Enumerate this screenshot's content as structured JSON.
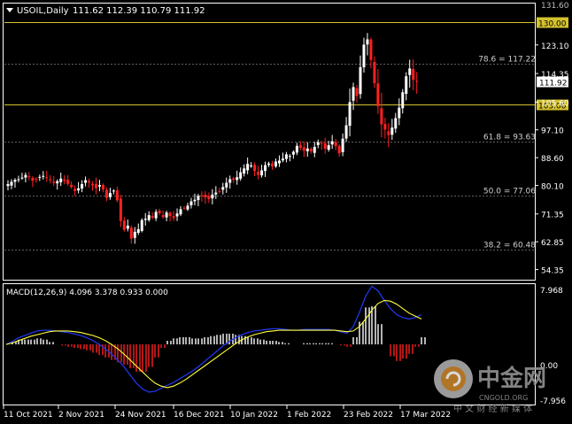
{
  "header": {
    "symbol": "USOIL,Daily",
    "ohlc": "111.62 112.39 110.79 111.92"
  },
  "price_axis": {
    "labels": [
      "123.10",
      "114.35",
      "105.60",
      "97.10",
      "88.60",
      "80.10",
      "71.35",
      "62.85",
      "54.35"
    ],
    "top_partial": "131.60",
    "current_price": "111.92",
    "level_130": "130.00",
    "level_105": "105.00"
  },
  "fib_levels": [
    {
      "label": "78.6 = 117.22",
      "price": 117.22
    },
    {
      "label": "61.8 = 93.63",
      "price": 93.63
    },
    {
      "label": "50.0 = 77.06",
      "price": 77.06
    },
    {
      "label": "38.2 = 60.48",
      "price": 60.48
    }
  ],
  "macd": {
    "label": "MACD(12,26,9) 4.096 3.378 0.933 0.000",
    "axis_top": "7.968",
    "axis_zero": "0.00",
    "axis_bottom": "-7.956"
  },
  "time_axis": [
    "11 Oct 2021",
    "2 Nov 2021",
    "24 Nov 2021",
    "16 Dec 2021",
    "10 Jan 2022",
    "1 Feb 2022",
    "23 Feb 2022",
    "17 Mar 2022"
  ],
  "watermark": {
    "brand": "中金网",
    "domain": "CNGOLD.ORG",
    "tagline": "中 文 财 经 新 媒 体"
  },
  "colors": {
    "background": "#000000",
    "bull": "#ffffff",
    "bear": "#ff2020",
    "horizontal_line": "#d4c22e",
    "macd_line": "#2035e6",
    "signal_line": "#ffff3c",
    "axis_text": "#ffffff",
    "grid": "#606060"
  },
  "chart_data": [
    {
      "type": "candlestick",
      "title": "USOIL,Daily",
      "x": [
        "11 Oct 2021",
        "2 Nov 2021",
        "24 Nov 2021",
        "16 Dec 2021",
        "10 Jan 2022",
        "1 Feb 2022",
        "23 Feb 2022",
        "17 Mar 2022"
      ],
      "ylim": [
        51.5,
        135.5
      ],
      "close_path": [
        80.5,
        81.2,
        81.8,
        82.0,
        82.5,
        83.3,
        82.8,
        81.5,
        82.0,
        82.7,
        83.0,
        82.3,
        81.7,
        80.9,
        81.4,
        82.2,
        81.5,
        80.6,
        79.6,
        78.4,
        79.2,
        80.5,
        81.7,
        81.0,
        80.1,
        79.3,
        80.2,
        78.9,
        76.3,
        77.8,
        78.5,
        75.5,
        69.2,
        66.5,
        67.8,
        63.8,
        65.9,
        66.7,
        69.5,
        69.9,
        71.0,
        70.2,
        72.0,
        71.6,
        70.4,
        71.8,
        70.7,
        70.1,
        71.5,
        72.8,
        73.1,
        73.9,
        75.2,
        75.7,
        76.9,
        77.0,
        76.4,
        75.9,
        77.3,
        77.9,
        78.2,
        79.6,
        80.9,
        82.0,
        81.8,
        82.6,
        84.1,
        85.3,
        86.7,
        86.2,
        84.5,
        83.3,
        84.7,
        86.3,
        86.8,
        85.9,
        87.4,
        87.7,
        88.3,
        89.6,
        89.1,
        90.4,
        92.2,
        91.6,
        90.7,
        91.4,
        90.5,
        91.9,
        93.3,
        92.9,
        91.3,
        92.4,
        93.6,
        92.1,
        89.9,
        94.4,
        98.5,
        105.6,
        110.2,
        107.5,
        116.3,
        123.2,
        124.8,
        118.5,
        111.4,
        104.3,
        98.8,
        97.2,
        95.5,
        97.8,
        100.7,
        103.9,
        108.6,
        113.5,
        115.9,
        112.4,
        111.9
      ]
    },
    {
      "type": "line",
      "title": "MACD(12,26,9) 4.096 3.378 0.933 0.000",
      "ylim": [
        -7.956,
        7.968
      ],
      "series": [
        {
          "name": "MACD",
          "values": [
            0.0,
            0.4,
            0.9,
            1.2,
            1.5,
            1.8,
            1.9,
            1.9,
            1.8,
            1.7,
            1.6,
            1.4,
            1.2,
            0.9,
            0.5,
            0.0,
            -0.6,
            -1.3,
            -2.1,
            -3.0,
            -4.1,
            -5.2,
            -6.0,
            -6.4,
            -6.3,
            -5.9,
            -5.5,
            -5.1,
            -4.6,
            -4.1,
            -3.6,
            -3.0,
            -2.3,
            -1.6,
            -0.9,
            -0.2,
            0.4,
            0.9,
            1.3,
            1.6,
            1.8,
            1.9,
            2.0,
            2.1,
            2.1,
            2.0,
            1.9,
            1.9,
            2.0,
            2.0,
            2.0,
            2.0,
            2.0,
            1.9,
            1.7,
            1.5,
            2.4,
            4.3,
            6.5,
            7.8,
            7.2,
            5.9,
            4.8,
            4.0,
            3.6,
            3.4,
            3.6,
            4.0
          ]
        },
        {
          "name": "Signal",
          "values": [
            0.0,
            0.2,
            0.5,
            0.8,
            1.1,
            1.3,
            1.5,
            1.7,
            1.8,
            1.8,
            1.8,
            1.7,
            1.6,
            1.4,
            1.2,
            0.9,
            0.5,
            0.0,
            -0.6,
            -1.3,
            -2.1,
            -2.9,
            -3.7,
            -4.5,
            -5.2,
            -5.6,
            -5.8,
            -5.6,
            -5.2,
            -4.7,
            -4.1,
            -3.5,
            -2.9,
            -2.3,
            -1.7,
            -1.1,
            -0.5,
            0.1,
            0.6,
            1.0,
            1.3,
            1.5,
            1.7,
            1.8,
            1.9,
            1.9,
            1.9,
            1.9,
            1.9,
            1.9,
            1.9,
            1.9,
            1.9,
            1.9,
            1.8,
            1.7,
            1.8,
            2.4,
            3.4,
            4.6,
            5.5,
            5.9,
            5.8,
            5.4,
            4.8,
            4.2,
            3.8,
            3.4
          ]
        }
      ]
    }
  ]
}
